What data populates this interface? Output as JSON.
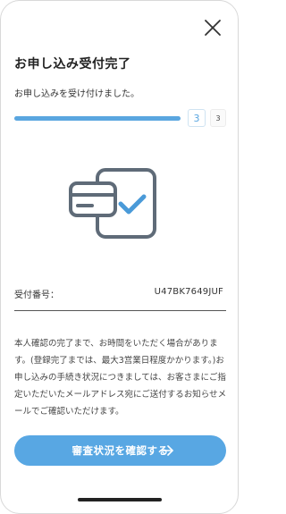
{
  "page": {
    "title": "お申し込み受付完了",
    "subtitle": "お申し込みを受け付けました。"
  },
  "progress": {
    "fraction": 1.0,
    "current_step": "3",
    "total_steps": "3"
  },
  "receipt": {
    "label": "受付番号：",
    "value": "U47BK7649JUF"
  },
  "notice": {
    "line1": "本人確認の完了まで、お時間をいただく場合があります。(登録完了までは、最大3営業日程度かかります。)",
    "line2": "お申し込みの手続き状況につきましては、お客さまにご指定いただいたメールアドレス宛にご送付するお知らせメールでご確認いただけます。"
  },
  "cta": {
    "label": "審査状況を確認する"
  },
  "icons": {
    "close": "close-icon",
    "illustration": "card-check-icon",
    "arrow": "arrow-right-icon"
  },
  "colors": {
    "accent": "#58a7e3",
    "illustration_gray": "#5f6b78",
    "illustration_blue": "#4a9ad8"
  }
}
